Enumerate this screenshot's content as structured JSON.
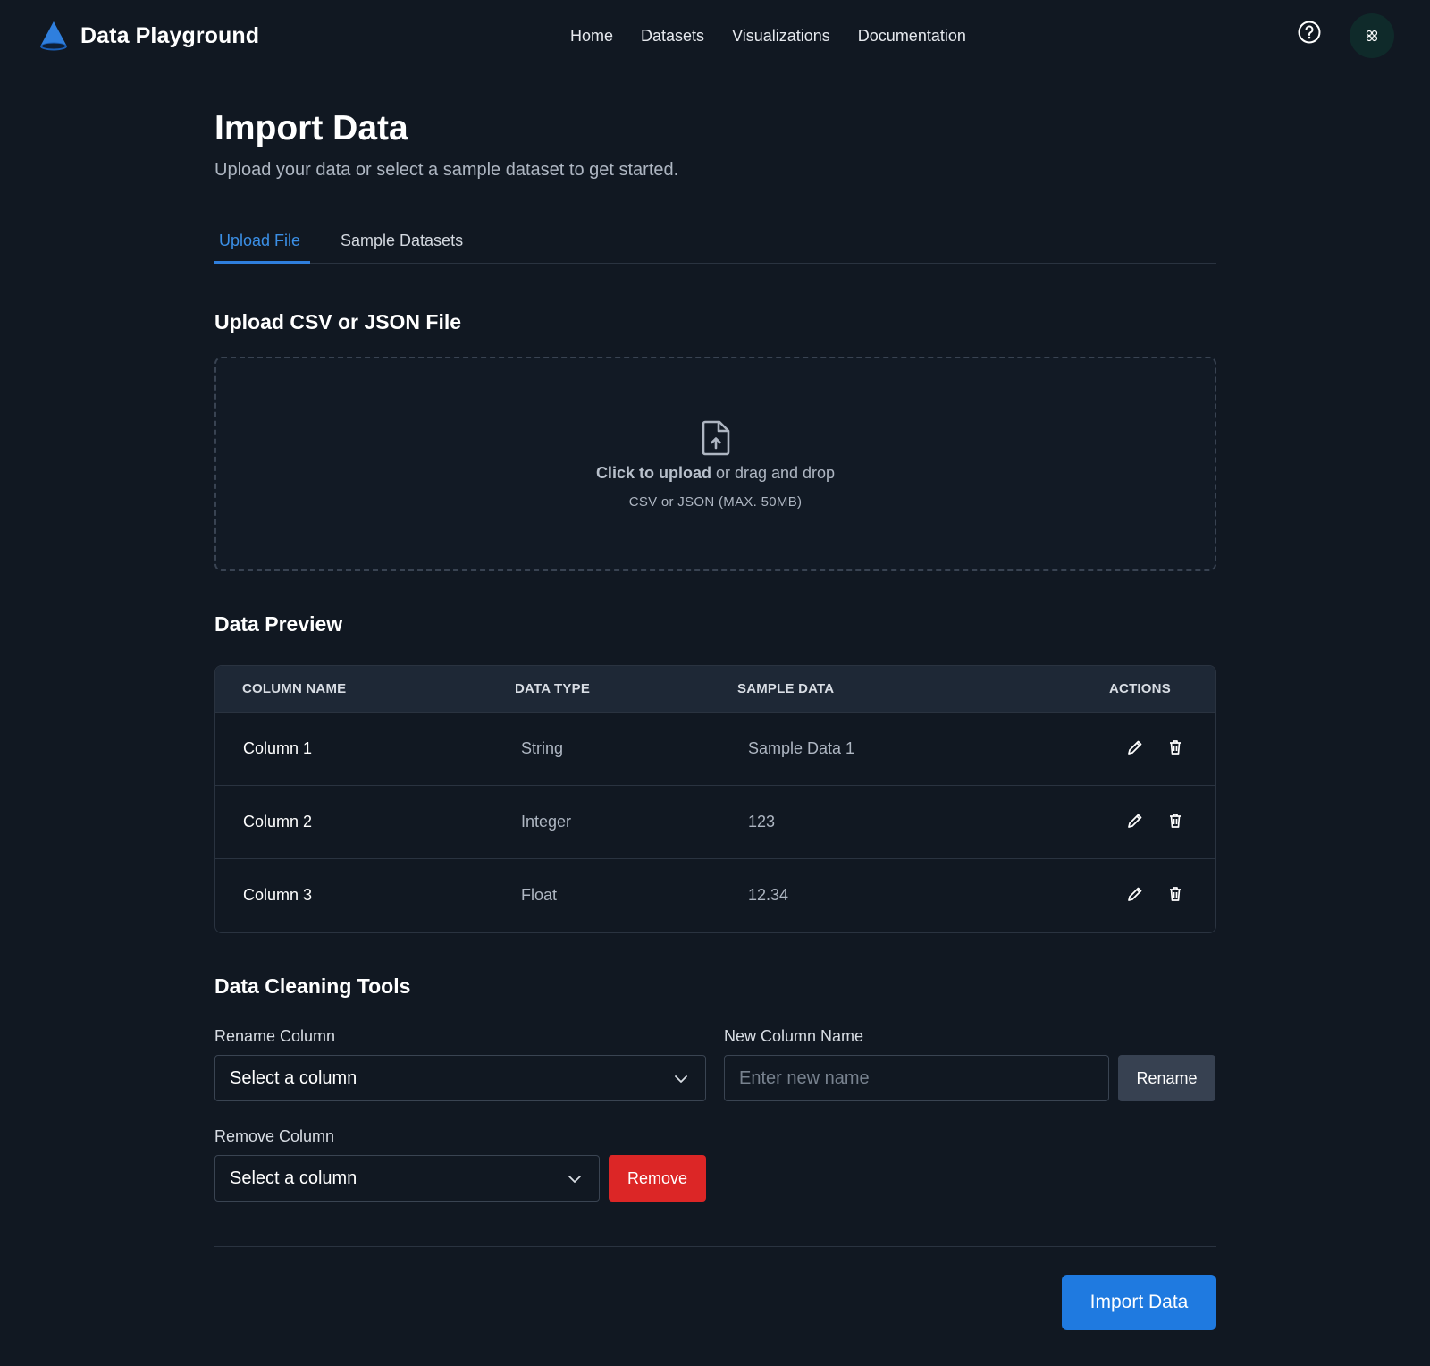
{
  "header": {
    "brand_title": "Data Playground",
    "nav": [
      "Home",
      "Datasets",
      "Visualizations",
      "Documentation"
    ],
    "help_icon": "help-circle-icon",
    "avatar_icon": "avatar-badge-icon"
  },
  "page": {
    "title": "Import Data",
    "subtitle": "Upload your data or select a sample dataset to get started."
  },
  "tabs": [
    {
      "label": "Upload File",
      "active": true
    },
    {
      "label": "Sample Datasets",
      "active": false
    }
  ],
  "upload": {
    "title": "Upload CSV or JSON File",
    "click_text": "Click to upload",
    "drag_text": " or drag and drop",
    "hint": "CSV or JSON (MAX. 50MB)",
    "icon": "file-upload-icon"
  },
  "preview": {
    "title": "Data Preview",
    "headers": [
      "COLUMN NAME",
      "DATA TYPE",
      "SAMPLE DATA",
      "ACTIONS"
    ],
    "rows": [
      {
        "name": "Column 1",
        "type": "String",
        "sample": "Sample Data 1"
      },
      {
        "name": "Column 2",
        "type": "Integer",
        "sample": "123"
      },
      {
        "name": "Column 3",
        "type": "Float",
        "sample": "12.34"
      }
    ]
  },
  "cleaning": {
    "title": "Data Cleaning Tools",
    "rename_label": "Rename Column",
    "rename_select": "Select a column",
    "new_name_label": "New Column Name",
    "new_name_placeholder": "Enter new name",
    "rename_button": "Rename",
    "remove_label": "Remove Column",
    "remove_select": "Select a column",
    "remove_button": "Remove"
  },
  "footer": {
    "import_button": "Import Data"
  },
  "colors": {
    "background": "#111822",
    "accent": "#1f7ae0",
    "danger": "#dc2626",
    "secondary_button": "#374151"
  }
}
